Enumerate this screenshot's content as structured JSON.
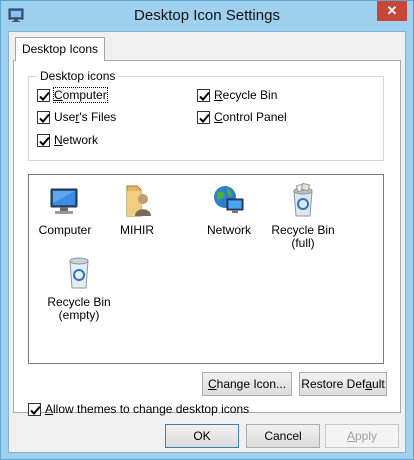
{
  "window": {
    "title": "Desktop Icon Settings",
    "close_glyph": "✕"
  },
  "tabs": [
    {
      "label": "Desktop Icons"
    }
  ],
  "desktop_icons_group": {
    "label": "Desktop icons",
    "checkboxes": [
      {
        "label_underline": "C",
        "label_rest": "omputer",
        "checked": true
      },
      {
        "label_underline": "R",
        "label_rest": "ecycle Bin",
        "checked": true
      },
      {
        "label_pre": "Use",
        "label_underline": "r",
        "label_rest": "'s Files",
        "checked": true
      },
      {
        "label_underline": "C",
        "label_rest": "ontrol Panel",
        "checked": true
      },
      {
        "label_underline": "N",
        "label_rest": "etwork",
        "checked": true
      }
    ]
  },
  "icon_list": [
    {
      "label": "Computer",
      "icon": "computer-icon"
    },
    {
      "label": "MIHIR",
      "icon": "user-folder-icon"
    },
    {
      "label": "Network",
      "icon": "network-icon"
    },
    {
      "label": "Recycle Bin\n(full)",
      "icon": "recycle-bin-full-icon"
    },
    {
      "label": "Recycle Bin\n(empty)",
      "icon": "recycle-bin-empty-icon"
    }
  ],
  "buttons": {
    "change_icon_pre": "",
    "change_icon_underline": "C",
    "change_icon_rest": "hange Icon...",
    "restore_default_pre": "Restore Def",
    "restore_default_underline": "a",
    "restore_default_rest": "ult",
    "ok": "OK",
    "cancel": "Cancel",
    "apply_underline": "A",
    "apply_rest": "pply"
  },
  "allow_themes": {
    "pre": "",
    "underline": "A",
    "rest": "llow themes to change desktop icons",
    "checked": true
  },
  "colors": {
    "title_bar": "#9fd0ee",
    "close_button": "#c7463a",
    "focus_border": "#3c7fb1"
  }
}
